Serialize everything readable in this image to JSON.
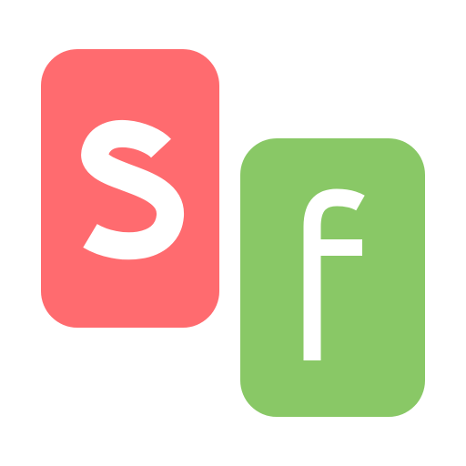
{
  "logo": {
    "letters": [
      "s",
      "f"
    ],
    "colors": {
      "red_card": "#ff6b6f",
      "green_card": "#89c866",
      "letter": "#ffffff",
      "background": "#ffffff"
    }
  }
}
